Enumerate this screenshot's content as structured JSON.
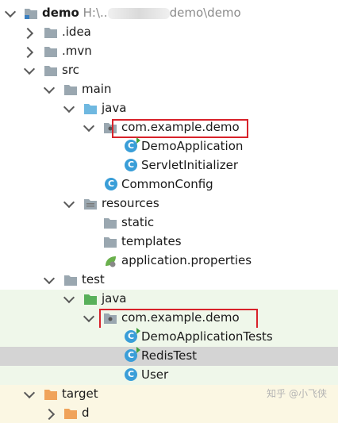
{
  "tree": {
    "root": {
      "name": "demo",
      "path_start": "H:\\..",
      "path_end": "demo\\demo"
    },
    "idea": ".idea",
    "mvn": ".mvn",
    "src": "src",
    "main": "main",
    "main_java": "java",
    "main_pkg": "com.example.demo",
    "demo_app": "DemoApplication",
    "servlet_init": "ServletInitializer",
    "common_config": "CommonConfig",
    "resources": "resources",
    "static": "static",
    "templates": "templates",
    "app_props": "application.properties",
    "test": "test",
    "test_java": "java",
    "test_pkg": "com.example.demo",
    "demo_app_tests": "DemoApplicationTests",
    "redis_test": "RedisTest",
    "user": "User",
    "target": "target",
    "partial": "d"
  },
  "class_icon_letter": "C",
  "watermark": "知乎 @小飞侠",
  "colors": {
    "folder": "#9aa7b0",
    "java_folder_main": "#6fb8e0",
    "java_folder_test": "#58b05a",
    "target_folder": "#f0a35a",
    "class_icon": "#3a9ed8",
    "highlight_box": "#d8222a"
  }
}
